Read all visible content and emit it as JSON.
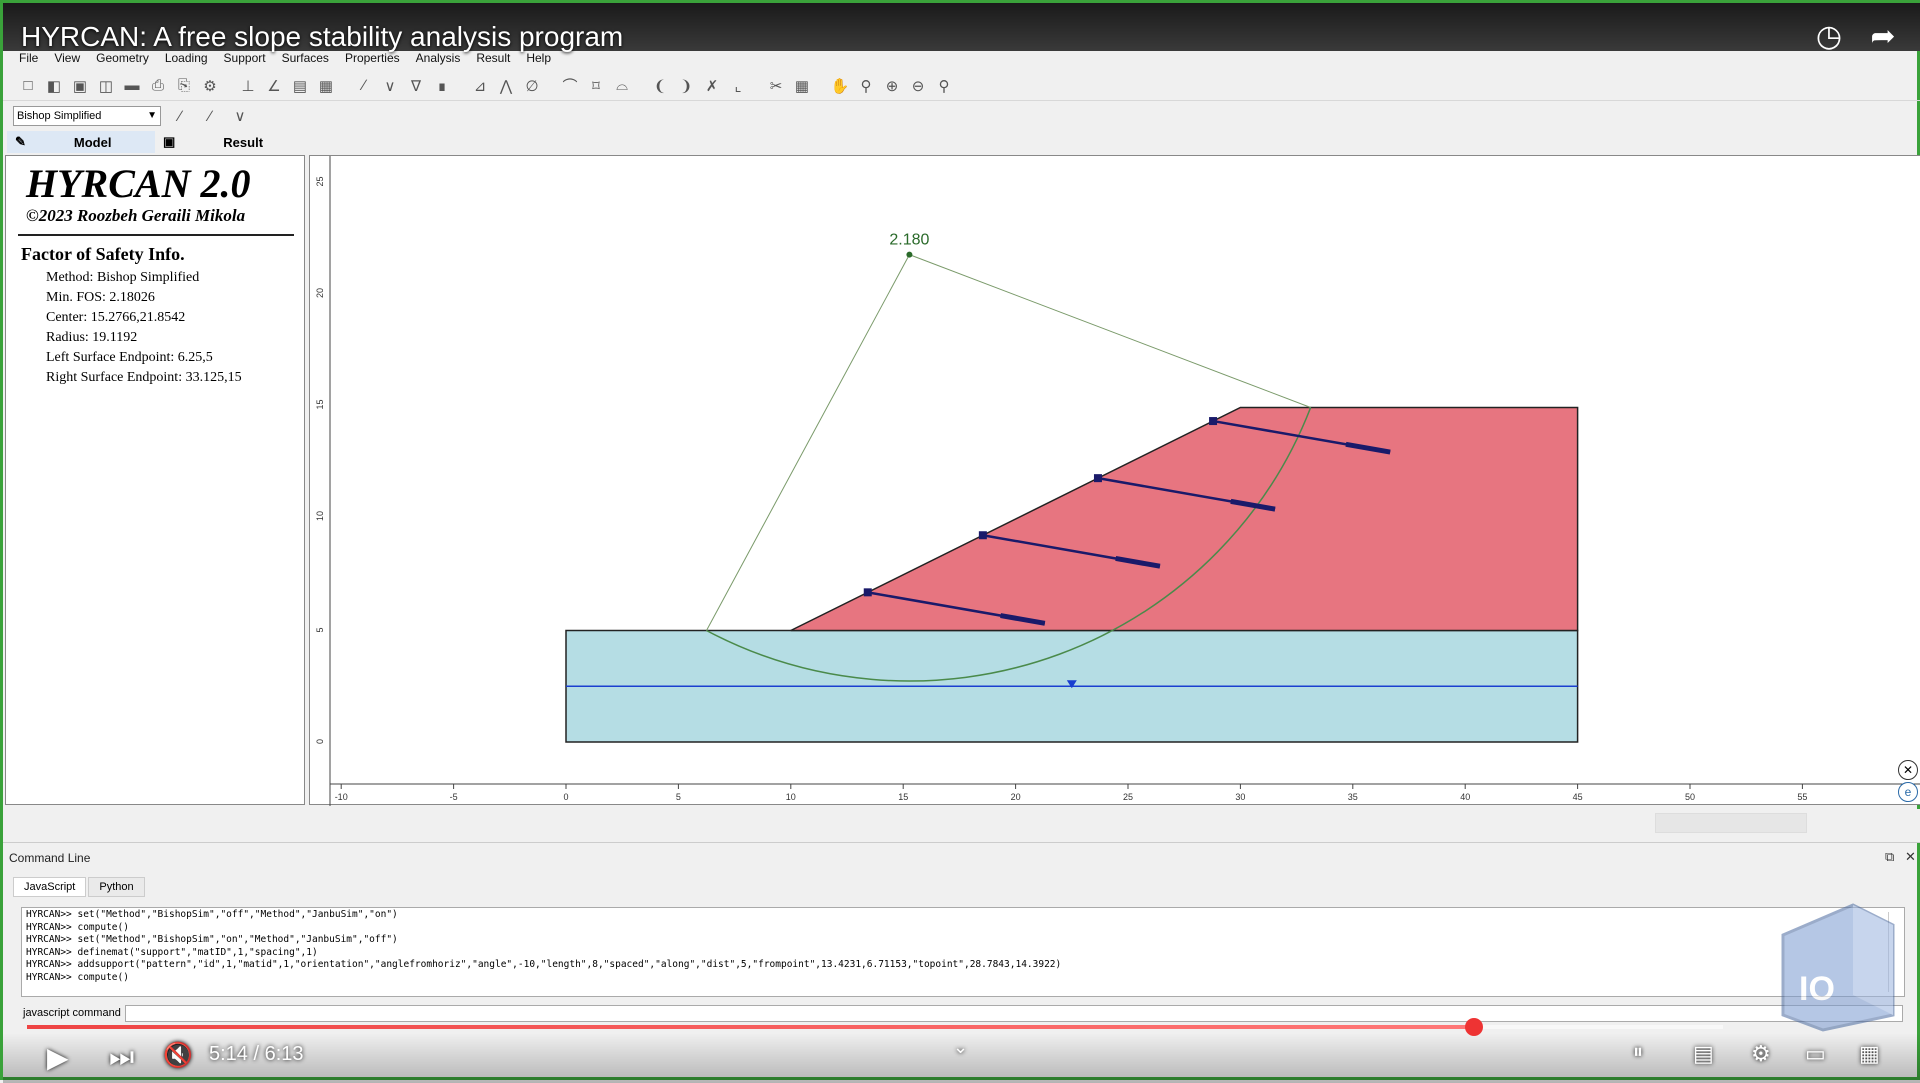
{
  "video": {
    "title": "HYRCAN: A free slope stability analysis program",
    "time": "5:14 / 6:13",
    "progress_fraction": 0.853
  },
  "menu": [
    "File",
    "View",
    "Geometry",
    "Loading",
    "Support",
    "Surfaces",
    "Properties",
    "Analysis",
    "Result",
    "Help"
  ],
  "toolbar": {
    "method": "Bishop Simplified"
  },
  "tabs": [
    {
      "label": "Model",
      "icon": "edit-icon"
    },
    {
      "label": "Result",
      "icon": "monitor-icon"
    }
  ],
  "info": {
    "app_name": "HYRCAN 2.0",
    "copyright": "©2023 Roozbeh Geraili Mikola",
    "heading": "Factor of Safety Info.",
    "lines": [
      "Method: Bishop Simplified",
      "Min. FOS: 2.18026",
      "Center: 15.2766,21.8542",
      "Radius: 19.1192",
      "Left Surface Endpoint: 6.25,5",
      "Right Surface Endpoint: 33.125,15"
    ]
  },
  "model": {
    "fos_label": "2.180",
    "x_ticks": [
      "-10",
      "-5",
      "0",
      "5",
      "10",
      "15",
      "20",
      "25",
      "30",
      "35",
      "40",
      "45",
      "50",
      "55"
    ],
    "y_ticks": [
      "0",
      "5",
      "10",
      "15",
      "20",
      "25"
    ],
    "colors": {
      "upper_material": "#e77580",
      "lower_material": "#b5dde4",
      "slip_surface": "#4a8a4a",
      "support": "#1a1a6a",
      "water_table": "#1a3fd0"
    }
  },
  "command_line": {
    "header": "Command Line",
    "tabs": [
      "JavaScript",
      "Python"
    ],
    "lines": [
      "HYRCAN>> set(\"Method\",\"BishopSim\",\"off\",\"Method\",\"JanbuSim\",\"on\")",
      "HYRCAN>> compute()",
      "HYRCAN>> set(\"Method\",\"BishopSim\",\"on\",\"Method\",\"JanbuSim\",\"off\")",
      "HYRCAN>> definemat(\"support\",\"matID\",1,\"spacing\",1)",
      "HYRCAN>> addsupport(\"pattern\",\"id\",1,\"matid\",1,\"orientation\",\"anglefromhoriz\",\"angle\",-10,\"length\",8,\"spaced\",\"along\",\"dist\",5,\"frompoint\",13.4231,6.71153,\"topoint\",28.7843,14.3922)",
      "HYRCAN>> compute()"
    ],
    "input_label": "javascript command",
    "input_value": ""
  }
}
